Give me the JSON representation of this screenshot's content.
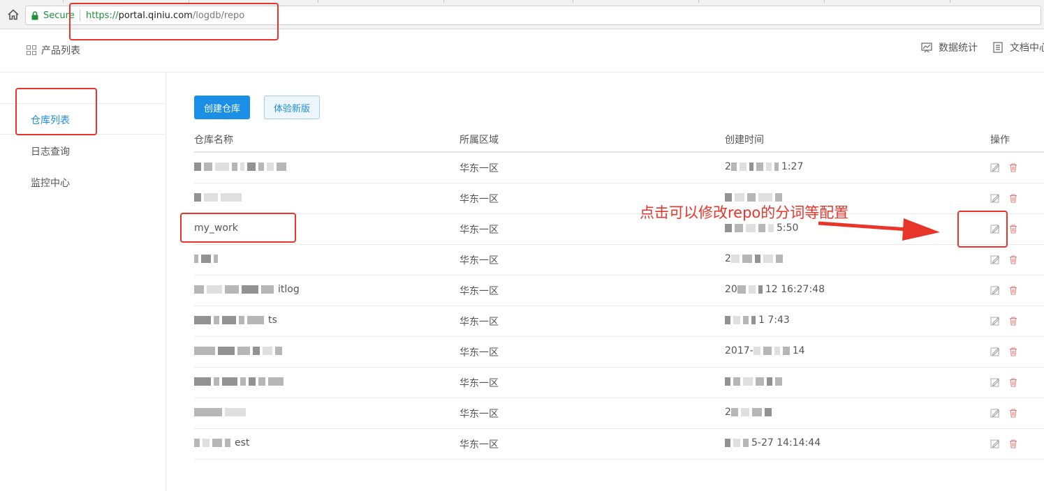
{
  "browser": {
    "secure_label": "Secure",
    "url_scheme": "https://",
    "url_host": "portal.qiniu.com",
    "url_path": "/logdb/repo"
  },
  "header": {
    "product_list": "产品列表",
    "stats": "数据统计",
    "docs": "文档中心"
  },
  "sidebar": {
    "items": [
      {
        "label": "仓库列表",
        "active": true
      },
      {
        "label": "日志查询"
      },
      {
        "label": "监控中心"
      }
    ]
  },
  "toolbar": {
    "create_label": "创建仓库",
    "try_new_label": "体验新版"
  },
  "table": {
    "headers": [
      "仓库名称",
      "所属区域",
      "创建时间",
      "操作"
    ],
    "rows": [
      {
        "name": "",
        "name_blur": "a",
        "region": "华东一区",
        "time_prefix": "2",
        "time_suffix": "1:27",
        "time_blur": "a"
      },
      {
        "name": "",
        "name_blur": "b",
        "region": "华东一区",
        "time_prefix": "",
        "time_suffix": "",
        "time_blur": "b"
      },
      {
        "name": "my_work",
        "name_blur": "",
        "region": "华东一区",
        "time_prefix": "",
        "time_suffix": "5:50",
        "time_blur": "c"
      },
      {
        "name": "",
        "name_blur": "c",
        "region": "华东一区",
        "time_prefix": "2",
        "time_suffix": "",
        "time_blur": "d"
      },
      {
        "name": "",
        "name_blur": "d",
        "name_suffix": "itlog",
        "region": "华东一区",
        "time_prefix": "20",
        "time_suffix": "12 16:27:48",
        "time_blur": "e"
      },
      {
        "name": "",
        "name_blur": "e",
        "name_suffix": "ts",
        "region": "华东一区",
        "time_prefix": "",
        "time_suffix": "1  7:43",
        "time_blur": "f"
      },
      {
        "name": "",
        "name_blur": "f",
        "region": "华东一区",
        "time_prefix": "2017-",
        "time_suffix": "14",
        "time_blur": "g"
      },
      {
        "name": "",
        "name_blur": "g",
        "region": "华东一区",
        "time_prefix": "",
        "time_suffix": "",
        "time_blur": "h"
      },
      {
        "name": "",
        "name_blur": "h",
        "region": "华东一区",
        "time_prefix": "2",
        "time_suffix": "",
        "time_blur": "i"
      },
      {
        "name": "",
        "name_blur": "i",
        "name_suffix": "est",
        "region": "华东一区",
        "time_prefix": "",
        "time_suffix": "5-27 14:14:44",
        "time_blur": "j"
      }
    ]
  },
  "annotation": {
    "text": "点击可以修改repo的分词等配置",
    "color": "#e8352a"
  },
  "colors": {
    "accent": "#1b8ee6",
    "delete": "#e87c7c"
  },
  "icons": {
    "home": "home-icon",
    "lock": "lock-icon",
    "grid": "grid-icon",
    "stats": "chart-icon",
    "docs": "document-icon",
    "edit": "edit-icon",
    "delete": "trash-icon"
  }
}
